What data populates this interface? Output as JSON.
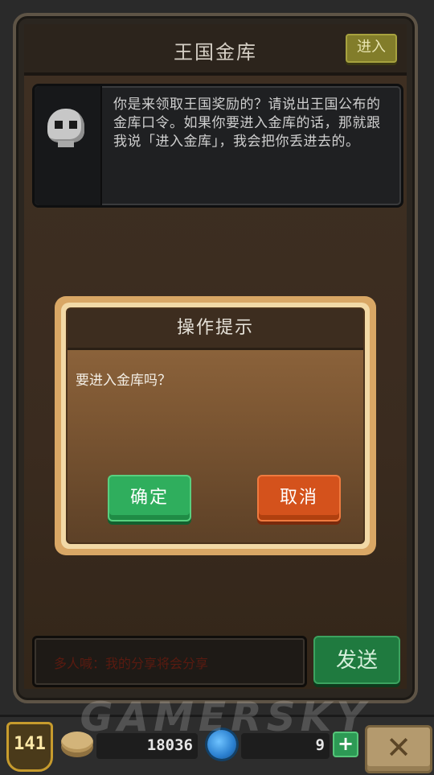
{
  "header": {
    "title": "王国金库",
    "enter_label": "进入"
  },
  "npc": {
    "portrait_icon": "skull-knight-icon",
    "message": "你是来领取王国奖励的？请说出王国公布的金库口令。如果你要进入金库的话，那就跟我说「进入金库」，我会把你丢进去的。"
  },
  "dialog": {
    "title": "操作提示",
    "message": "要进入金库吗？",
    "confirm_label": "确定",
    "cancel_label": "取消"
  },
  "chat": {
    "placeholder": "多人喊：我的分享将会分享",
    "send_label": "发送"
  },
  "status_bar": {
    "level": "141",
    "gold": "18036",
    "gems": "9",
    "plus_label": "+",
    "close_label": "✕"
  },
  "watermark": "GAMERSKY",
  "colors": {
    "confirm": "#2fae5d",
    "cancel": "#d4521c",
    "send": "#1f7a3f",
    "enter": "#827d2a"
  }
}
